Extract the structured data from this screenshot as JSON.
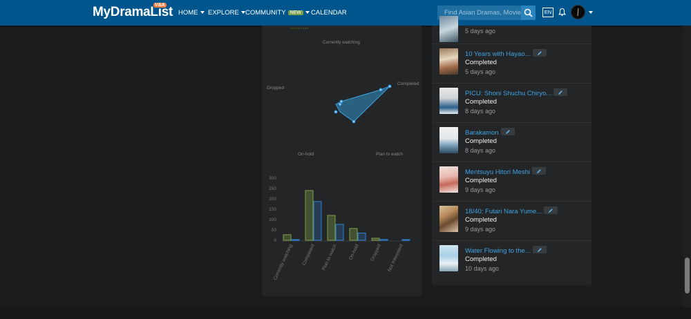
{
  "navbar": {
    "logo": "MyDramaList",
    "logo_badge": "V&A",
    "items": [
      {
        "label": "HOME"
      },
      {
        "label": "EXPLORE"
      },
      {
        "label": "COMMUNITY",
        "badge": "NEW"
      },
      {
        "label": "CALENDAR"
      }
    ],
    "search_placeholder": "Find Asian Dramas, Movies",
    "language": "EN",
    "icons": [
      "search-icon",
      "bell-icon",
      "avatar"
    ],
    "accent": "#00568c"
  },
  "stats": {
    "radar_labels": {
      "top": "Currently watching",
      "right": "Completed",
      "left": "Dropped",
      "bottom_left": "On-hold",
      "bottom_right": "Plan to watch"
    }
  },
  "chart_data": {
    "type": "bar",
    "categories": [
      "Currently watching",
      "Completed",
      "Plan to watch",
      "On-hold",
      "Dropped",
      "Not Interested"
    ],
    "series": [
      {
        "values": [
          27,
          240,
          120,
          57,
          10,
          0
        ],
        "color": "#7ea04a"
      },
      {
        "values": [
          3,
          187,
          77,
          35,
          4,
          2
        ],
        "color": "#2a83d6"
      }
    ],
    "yticks": [
      "300",
      "250",
      "200",
      "150",
      "100",
      "50",
      "0"
    ],
    "ylim": [
      0,
      300
    ]
  },
  "feed": [
    {
      "title": "",
      "status": "",
      "time": "5 days ago"
    },
    {
      "title": "10 Years with Hayao...",
      "status": "Completed",
      "time": "5 days ago"
    },
    {
      "title": "PICU: Shoni Shuchu Chiryo...",
      "status": "Completed",
      "time": "8 days ago"
    },
    {
      "title": "Barakamon",
      "status": "Completed",
      "time": "8 days ago"
    },
    {
      "title": "Mentsuyu Hitori Meshi",
      "status": "Completed",
      "time": "9 days ago"
    },
    {
      "title": "18/40: Futari Nara Yume...",
      "status": "Completed",
      "time": "9 days ago"
    },
    {
      "title": "Water Flowing to the...",
      "status": "Completed",
      "time": "10 days ago"
    }
  ]
}
